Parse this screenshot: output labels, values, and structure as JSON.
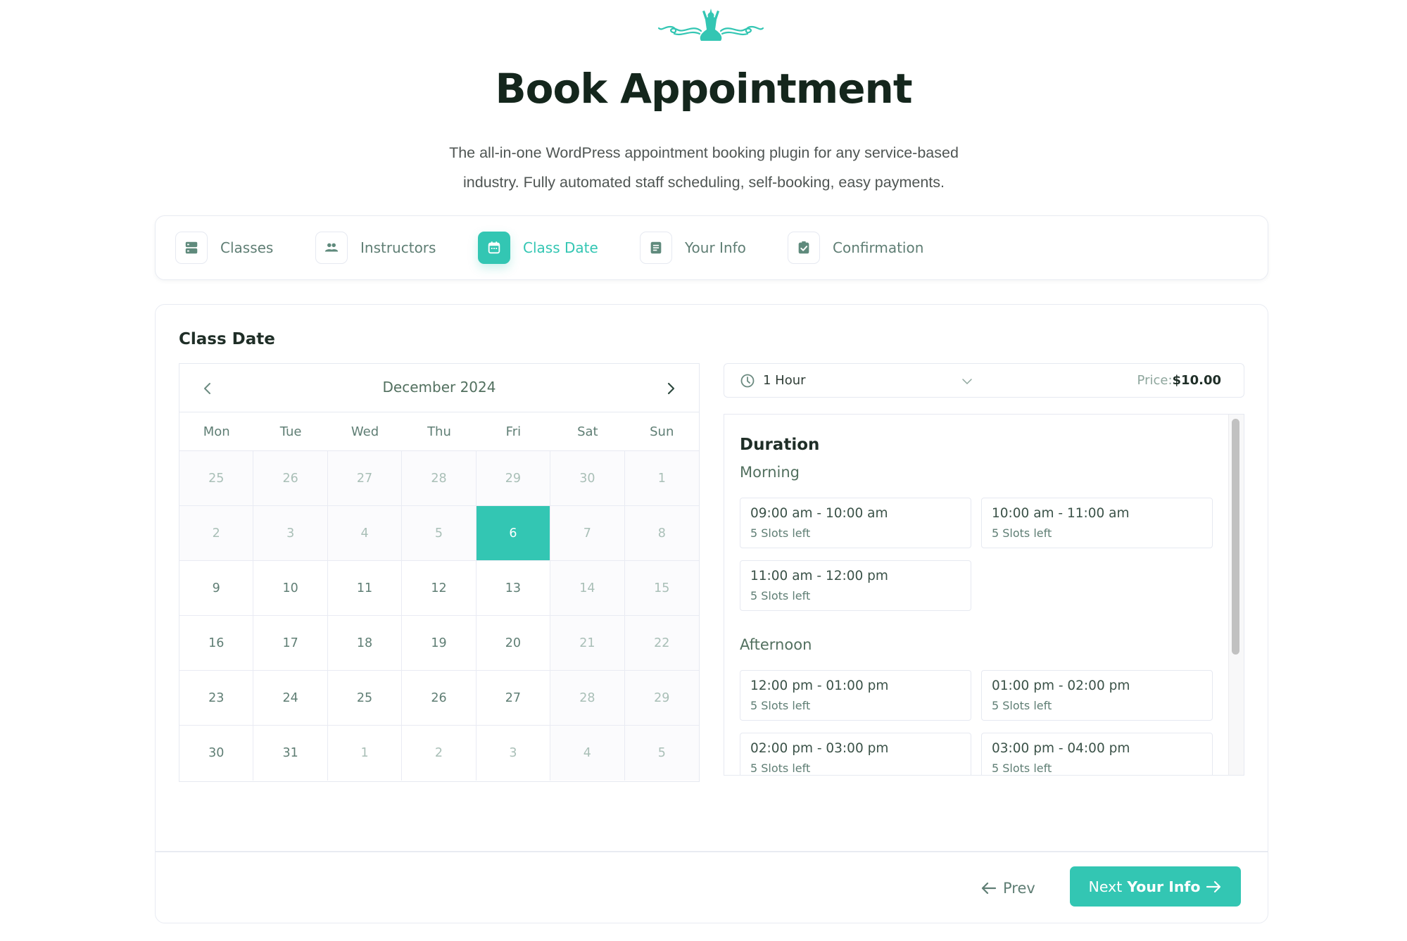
{
  "header": {
    "logo": "yoga-ornament-logo",
    "title": "Book Appointment",
    "subtitle_line1": "The all-in-one WordPress appointment booking plugin for any service-based",
    "subtitle_line2": "industry. Fully automated staff scheduling, self-booking, easy payments."
  },
  "steps": [
    {
      "label": "Classes",
      "icon": "server-stack-icon",
      "active": false
    },
    {
      "label": "Instructors",
      "icon": "users-icon",
      "active": false
    },
    {
      "label": "Class Date",
      "icon": "calendar-icon",
      "active": true
    },
    {
      "label": "Your Info",
      "icon": "document-icon",
      "active": false
    },
    {
      "label": "Confirmation",
      "icon": "clipboard-check-icon",
      "active": false
    }
  ],
  "section_title": "Class Date",
  "calendar": {
    "month_label": "December 2024",
    "weekdays": [
      "Mon",
      "Tue",
      "Wed",
      "Thu",
      "Fri",
      "Sat",
      "Sun"
    ],
    "selected_day": "6",
    "days": [
      {
        "d": "25",
        "s": "disabled"
      },
      {
        "d": "26",
        "s": "disabled"
      },
      {
        "d": "27",
        "s": "disabled"
      },
      {
        "d": "28",
        "s": "disabled"
      },
      {
        "d": "29",
        "s": "disabled"
      },
      {
        "d": "30",
        "s": "disabled"
      },
      {
        "d": "1",
        "s": "disabled"
      },
      {
        "d": "2",
        "s": "disabled"
      },
      {
        "d": "3",
        "s": "disabled"
      },
      {
        "d": "4",
        "s": "disabled"
      },
      {
        "d": "5",
        "s": "disabled"
      },
      {
        "d": "6",
        "s": "selected"
      },
      {
        "d": "7",
        "s": "disabled"
      },
      {
        "d": "8",
        "s": "disabled"
      },
      {
        "d": "9",
        "s": ""
      },
      {
        "d": "10",
        "s": ""
      },
      {
        "d": "11",
        "s": ""
      },
      {
        "d": "12",
        "s": ""
      },
      {
        "d": "13",
        "s": ""
      },
      {
        "d": "14",
        "s": "weekend"
      },
      {
        "d": "15",
        "s": "weekend"
      },
      {
        "d": "16",
        "s": ""
      },
      {
        "d": "17",
        "s": ""
      },
      {
        "d": "18",
        "s": ""
      },
      {
        "d": "19",
        "s": ""
      },
      {
        "d": "20",
        "s": ""
      },
      {
        "d": "21",
        "s": "weekend"
      },
      {
        "d": "22",
        "s": "weekend"
      },
      {
        "d": "23",
        "s": ""
      },
      {
        "d": "24",
        "s": ""
      },
      {
        "d": "25",
        "s": ""
      },
      {
        "d": "26",
        "s": ""
      },
      {
        "d": "27",
        "s": ""
      },
      {
        "d": "28",
        "s": "weekend"
      },
      {
        "d": "29",
        "s": "weekend"
      },
      {
        "d": "30",
        "s": ""
      },
      {
        "d": "31",
        "s": ""
      },
      {
        "d": "1",
        "s": "outside"
      },
      {
        "d": "2",
        "s": "outside"
      },
      {
        "d": "3",
        "s": "outside"
      },
      {
        "d": "4",
        "s": "weekend"
      },
      {
        "d": "5",
        "s": "weekend"
      }
    ]
  },
  "duration_select": {
    "value": "1 Hour",
    "price_label": "Price:",
    "price_value": "$10.00"
  },
  "slots": {
    "title": "Duration",
    "periods": [
      {
        "label": "Morning",
        "items": [
          {
            "time": "09:00 am - 10:00 am",
            "left": "5 Slots left"
          },
          {
            "time": "10:00 am - 11:00 am",
            "left": "5 Slots left"
          },
          {
            "time": "11:00 am - 12:00 pm",
            "left": "5 Slots left"
          }
        ]
      },
      {
        "label": "Afternoon",
        "items": [
          {
            "time": "12:00 pm - 01:00 pm",
            "left": "5 Slots left"
          },
          {
            "time": "01:00 pm - 02:00 pm",
            "left": "5 Slots left"
          },
          {
            "time": "02:00 pm - 03:00 pm",
            "left": "5 Slots left"
          },
          {
            "time": "03:00 pm - 04:00 pm",
            "left": "5 Slots left"
          }
        ]
      }
    ]
  },
  "footer": {
    "prev_label": "Prev",
    "next_label": "Next",
    "next_step_label": "Your Info"
  },
  "colors": {
    "accent": "#33c6b3",
    "text_muted": "#5f7e74",
    "title_dark": "#14261c"
  }
}
